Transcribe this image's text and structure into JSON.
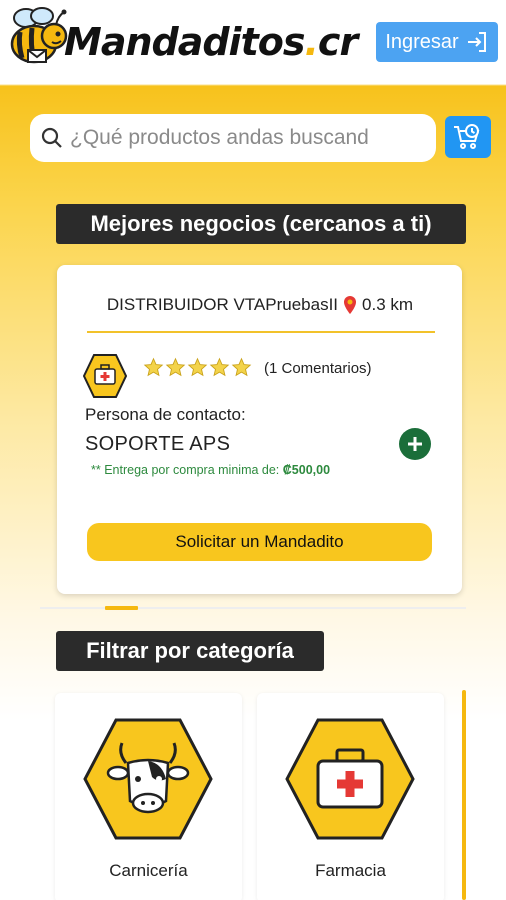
{
  "header": {
    "logo_text_main": "Mandaditos",
    "logo_text_dot": ".",
    "logo_text_tld": "cr",
    "login_label": "Ingresar"
  },
  "search": {
    "placeholder": "¿Qué productos andas buscand"
  },
  "best_businesses": {
    "title": "Mejores negocios (cercanos a ti)",
    "card": {
      "name": "DISTRIBUIDOR VTAPruebasII",
      "distance": "0.3 km",
      "rating": 5,
      "comments": "(1 Comentarios)",
      "contact_label": "Persona de contacto:",
      "contact_name": "SOPORTE APS",
      "delivery_prefix": "** Entrega por compra minima de: ",
      "delivery_amount": "₡500,00",
      "request_label": "Solicitar un Mandadito"
    }
  },
  "categories": {
    "title": "Filtrar por categoría",
    "items": [
      {
        "label": "Carnicería",
        "icon": "cow-icon"
      },
      {
        "label": "Farmacia",
        "icon": "first-aid-kit-icon"
      }
    ]
  },
  "colors": {
    "brand_yellow": "#f8c61e",
    "dark_label_bg": "#2b2b2b",
    "login_blue": "#4ca3f2",
    "cart_blue": "#2196f3",
    "delivery_green": "#2d8a3e",
    "add_green": "#1b6e3a"
  }
}
